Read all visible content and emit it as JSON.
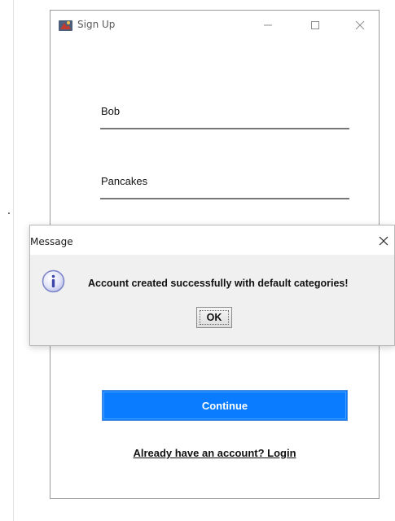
{
  "window": {
    "title": "Sign Up",
    "controls": {
      "minimize_icon": "minimize-icon",
      "maximize_icon": "maximize-icon",
      "close_icon": "close-icon"
    }
  },
  "form": {
    "fields": [
      {
        "value": "Bob"
      },
      {
        "value": "Pancakes"
      }
    ],
    "continue_label": "Continue",
    "login_link": "Already have an account? Login"
  },
  "dialog": {
    "title": "Message",
    "message": "Account created successfully with default categories!",
    "ok_label": "OK",
    "icon": "information-icon"
  },
  "colors": {
    "primary_button": "#0a7cff",
    "dialog_background": "#f0f0f0",
    "field_underline": "#777777"
  }
}
